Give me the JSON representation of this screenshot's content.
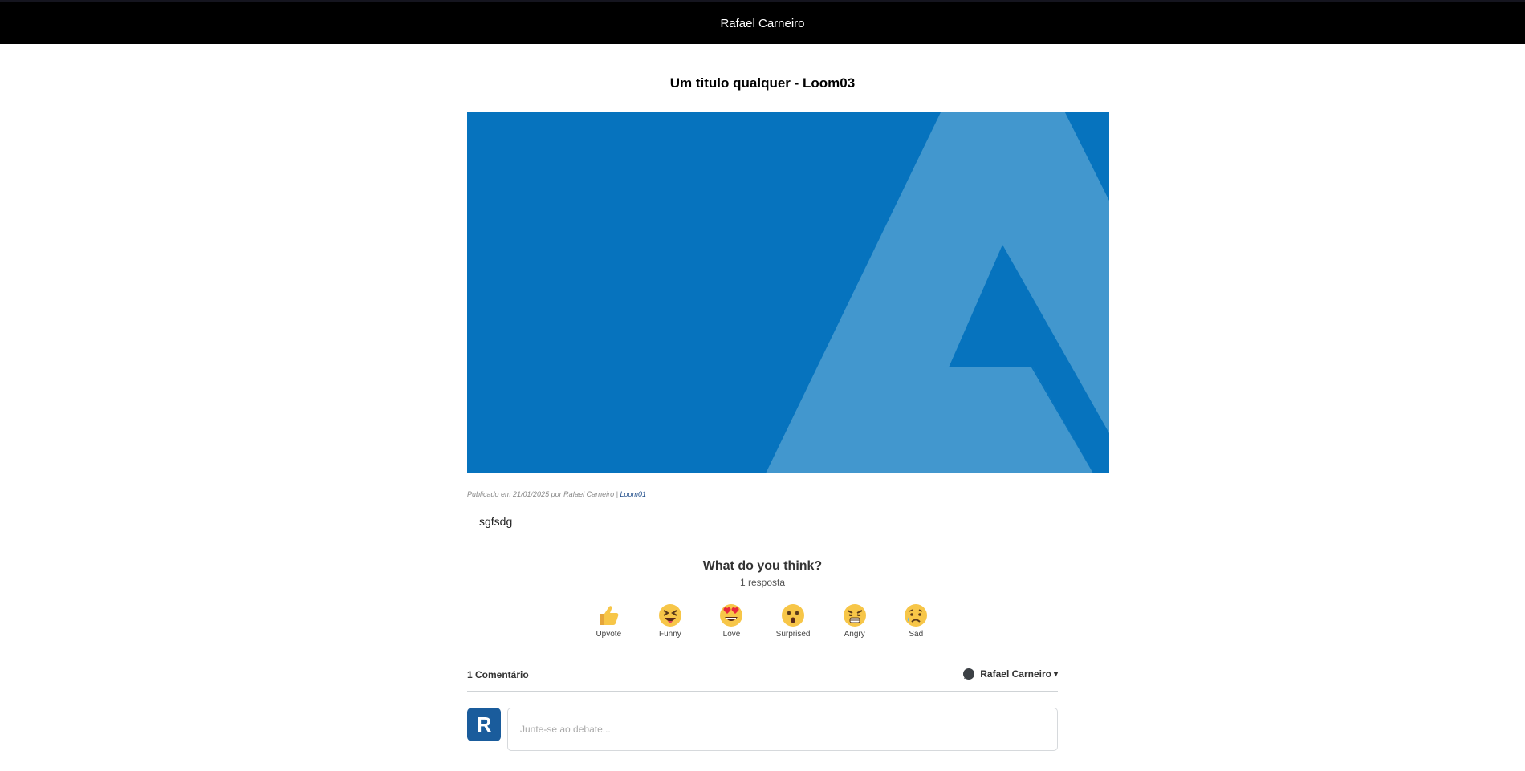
{
  "header": {
    "title": "Rafael Carneiro"
  },
  "post": {
    "title": "Um titulo qualquer - Loom03",
    "meta_prefix": "Publicado em 21/01/2025 por Rafael Carneiro |",
    "meta_link": "Loom01",
    "body": "sgfsdg"
  },
  "reactions": {
    "title": "What do you think?",
    "count": "1 resposta",
    "items": [
      {
        "label": "Upvote",
        "icon": "thumbs-up-icon"
      },
      {
        "label": "Funny",
        "icon": "laughing-icon"
      },
      {
        "label": "Love",
        "icon": "heart-eyes-icon"
      },
      {
        "label": "Surprised",
        "icon": "surprised-icon"
      },
      {
        "label": "Angry",
        "icon": "angry-icon"
      },
      {
        "label": "Sad",
        "icon": "sad-icon"
      }
    ]
  },
  "comments": {
    "count_label": "1 Comentário",
    "user_name": "Rafael Carneiro",
    "avatar_letter": "R",
    "input_placeholder": "Junte-se ao debate..."
  },
  "colors": {
    "topbar": "#000000",
    "hero_blue": "#0673be",
    "hero_light_blue": "#4297ce",
    "avatar": "#1a5c9c"
  }
}
